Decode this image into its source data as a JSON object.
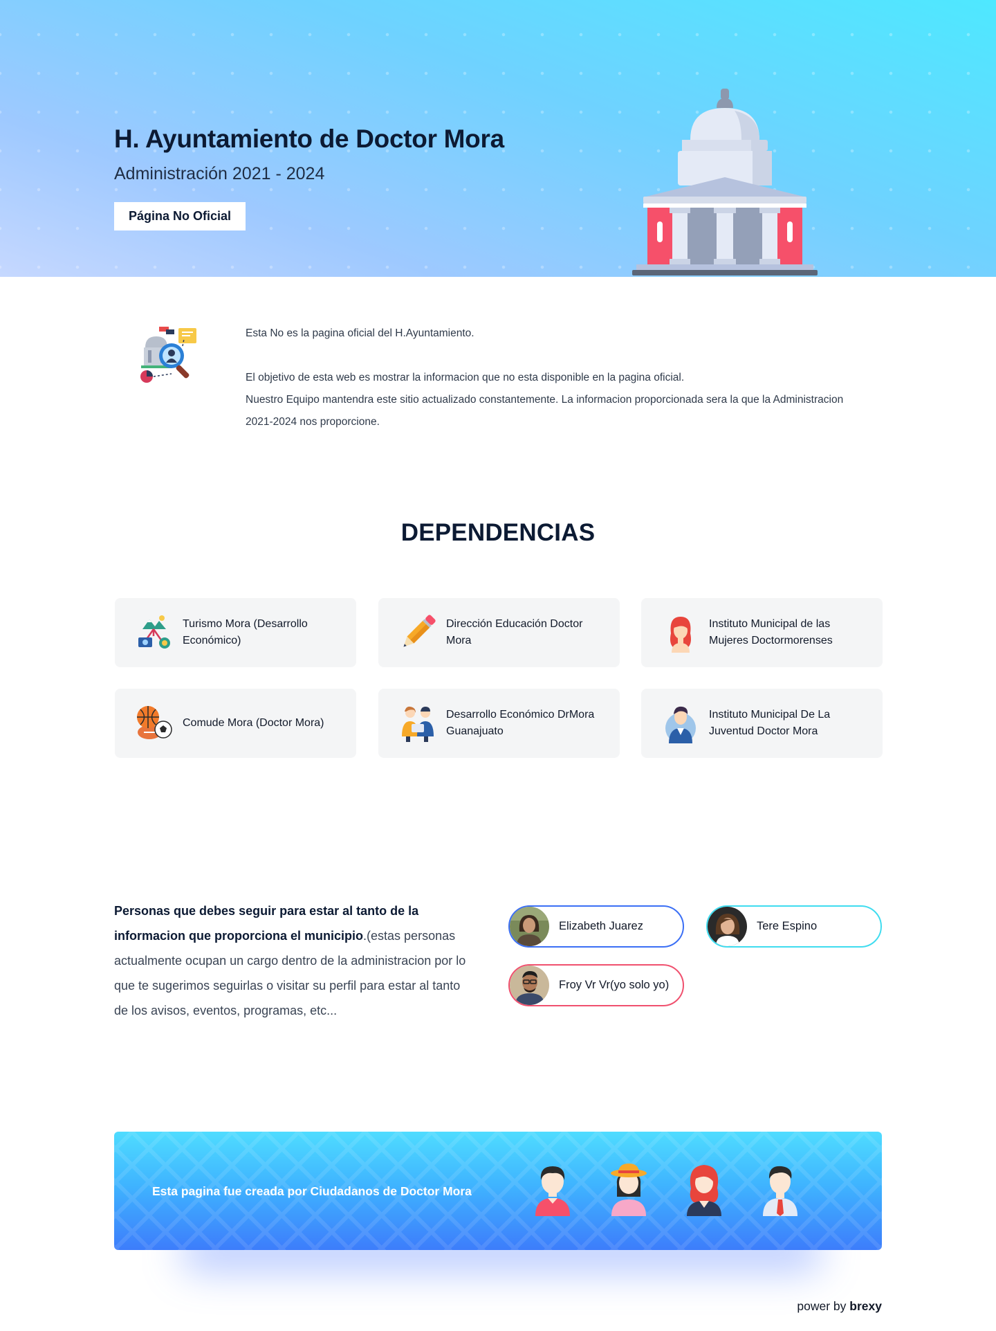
{
  "hero": {
    "title": "H. Ayuntamiento de Doctor Mora",
    "subtitle": "Administración 2021 - 2024",
    "button_label": "Página No Oficial"
  },
  "intro": {
    "line1": "Esta No es la pagina oficial del H.Ayuntamiento.",
    "line2": "El objetivo de esta web es mostrar la informacion que no esta disponible en la pagina oficial.",
    "line3": "Nuestro Equipo mantendra este sitio actualizado constantemente. La informacion proporcionada sera la que la Administracion 2021-2024 nos proporcione."
  },
  "dependencias": {
    "title": "DEPENDENCIAS",
    "items": [
      {
        "label": "Turismo Mora (Desarrollo Económico)",
        "icon": "tourism-icon"
      },
      {
        "label": "Dirección Educación Doctor Mora",
        "icon": "pencil-icon"
      },
      {
        "label": "Instituto Municipal de las Mujeres Doctormorenses",
        "icon": "woman-icon"
      },
      {
        "label": "Comude Mora (Doctor Mora)",
        "icon": "sports-balls-icon"
      },
      {
        "label": "Desarrollo Económico DrMora Guanajuato",
        "icon": "business-people-icon"
      },
      {
        "label": "Instituto Municipal De La Juventud Doctor Mora",
        "icon": "young-man-icon"
      }
    ]
  },
  "people": {
    "intro_bold": "Personas que debes seguir para estar al tanto de la informacion que proporciona el municipio",
    "intro_rest": ".(estas personas actualmente ocupan un cargo dentro de la administracion por lo que te sugerimos seguirlas o visitar su perfil para estar al tanto de los avisos, eventos, programas, etc...",
    "list": [
      {
        "name": "Elizabeth Juarez",
        "border_color": "#3b6ff5"
      },
      {
        "name": "Tere Espino",
        "border_color": "#3fdcef"
      },
      {
        "name": "Froy Vr Vr(yo solo yo)",
        "border_color": "#f0506e"
      }
    ]
  },
  "banner": {
    "text": "Esta pagina fue creada por Ciudadanos de Doctor Mora"
  },
  "footer": {
    "prefix": "power by",
    "brand": "brexy"
  },
  "colors": {
    "hero_top": "#4ee8ff",
    "hero_bottom": "#c6d8ff",
    "capitol_red": "#f6506a",
    "card_bg": "#f4f5f6",
    "banner_top": "#4fdcff",
    "banner_bottom": "#3d7dfb"
  }
}
